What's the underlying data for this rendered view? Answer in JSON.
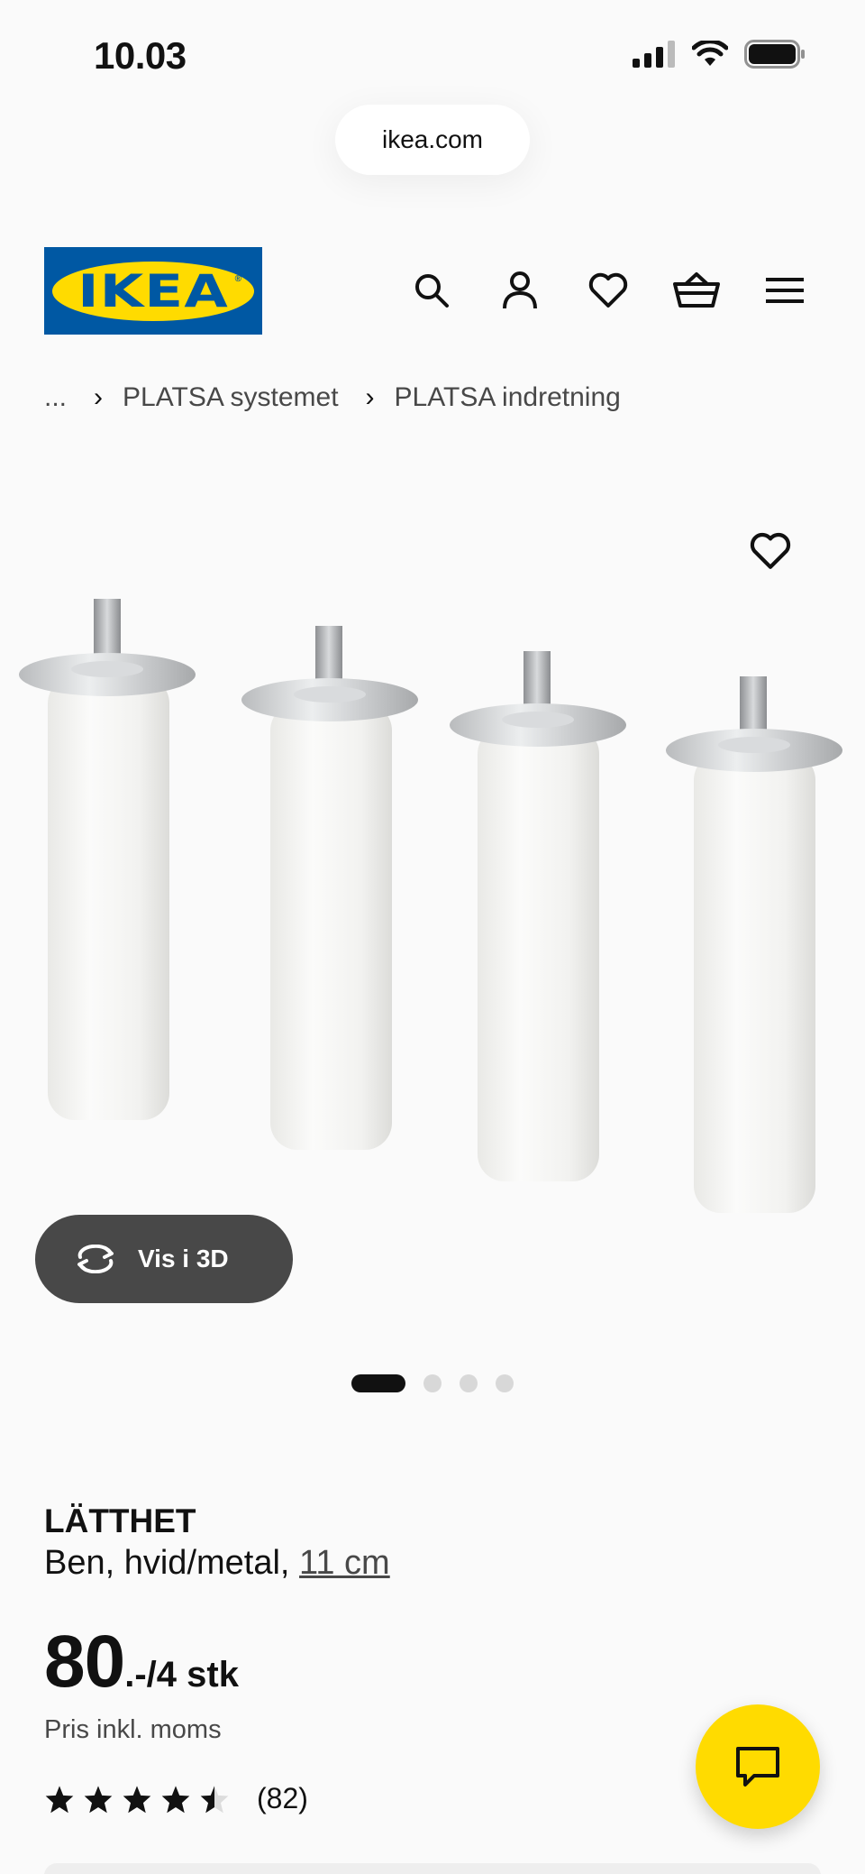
{
  "status": {
    "time": "10.03"
  },
  "browser": {
    "url": "ikea.com"
  },
  "header": {
    "logo_text": "IKEA",
    "icons": [
      "search-icon",
      "profile-icon",
      "favourites-icon",
      "basket-icon",
      "menu-icon"
    ]
  },
  "breadcrumb": {
    "ellipsis": "...",
    "items": [
      "PLATSA systemet",
      "PLATSA indretning"
    ]
  },
  "gallery": {
    "view3d_label": "Vis i 3D",
    "slides": 4,
    "active_slide": 1
  },
  "product": {
    "name": "LÄTTHET",
    "desc_prefix": "Ben, hvid/metal,",
    "size": "11 cm",
    "price_main": "80",
    "price_suffix": ".-/4 stk",
    "price_note": "Pris inkl. moms",
    "rating": 4.5,
    "rating_max": 5,
    "review_count": "(82)"
  },
  "colors": {
    "brand_blue": "#0058a3",
    "brand_yellow": "#ffdb00",
    "button_dark": "#484848"
  }
}
